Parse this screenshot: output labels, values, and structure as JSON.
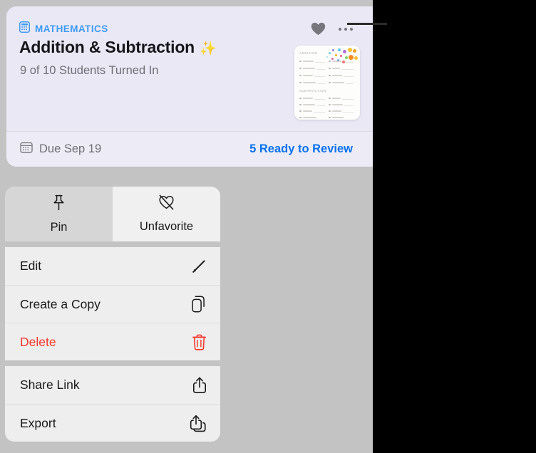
{
  "colors": {
    "backdrop": "#c3c3c3",
    "card_bg": "#eae8f5",
    "card_footer_bg": "#edecf6",
    "accent_blue": "#0a72ef",
    "subject_blue": "#3d9bf7",
    "danger_red": "#f7352b",
    "menu_bg": "#eeeeee",
    "menu_grid_bg": "#d6d6d6",
    "menu_grid_active_bg": "#f0f0f0"
  },
  "card": {
    "subject": "MATHEMATICS",
    "subject_icon": "calculator-icon",
    "title": "Addition & Subtraction",
    "title_emoji": "✨",
    "subtitle": "9 of 10 Students Turned In",
    "favorite_icon": "heart-filled-icon",
    "more_icon": "ellipsis-icon",
    "thumbnail": {
      "name": "worksheet-thumbnail",
      "section_1": "ADDITION",
      "section_2": "SUBTRACTION"
    },
    "footer": {
      "due_icon": "calendar-icon",
      "due_label": "Due Sep 19",
      "review_label": "5 Ready to Review"
    }
  },
  "context_menu": {
    "grid": [
      {
        "label": "Pin",
        "icon": "pin-icon",
        "active": false
      },
      {
        "label": "Unfavorite",
        "icon": "heart-slash-icon",
        "active": true
      }
    ],
    "group_1": [
      {
        "label": "Edit",
        "icon": "pencil-icon",
        "danger": false
      },
      {
        "label": "Create a Copy",
        "icon": "duplicate-icon",
        "danger": false
      },
      {
        "label": "Delete",
        "icon": "trash-icon",
        "danger": true
      }
    ],
    "group_2": [
      {
        "label": "Share Link",
        "icon": "share-icon",
        "danger": false
      },
      {
        "label": "Export",
        "icon": "export-icon",
        "danger": false
      }
    ]
  }
}
